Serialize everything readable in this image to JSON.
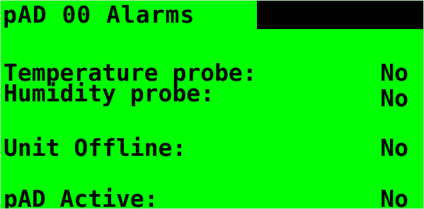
{
  "header": {
    "title": "pAD 00 Alarms"
  },
  "alarms": [
    {
      "label": "Temperature probe:",
      "value": "No"
    },
    {
      "label": "Humidity probe:",
      "value": "No"
    },
    {
      "label": "Unit Offline:",
      "value": "No"
    },
    {
      "label": "pAD Active:",
      "value": "No"
    }
  ],
  "colors": {
    "screen_bg": "#00ff00",
    "text": "#000000",
    "header_bar": "#000000"
  }
}
